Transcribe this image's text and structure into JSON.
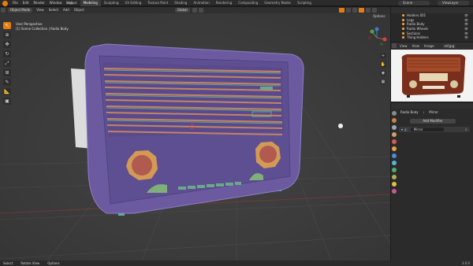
{
  "menu": {
    "items": [
      "File",
      "Edit",
      "Render",
      "Window",
      "Help"
    ]
  },
  "workspace_tabs": [
    "Layout",
    "Modeling",
    "Sculpting",
    "UV Editing",
    "Texture Paint",
    "Shading",
    "Animation",
    "Rendering",
    "Compositing",
    "Geometry Nodes",
    "Scripting"
  ],
  "active_tab": "Modeling",
  "scene_name": "Scene",
  "view_layer": "ViewLayer",
  "viewport": {
    "mode": "Object Mode",
    "menus": [
      "View",
      "Select",
      "Add",
      "Object"
    ],
    "orientation": "Global",
    "info_line1": "User Perspective",
    "info_line2": "(1) Scene Collection | Radio Body",
    "options_label": "Options"
  },
  "outliner": {
    "rows": [
      "Holders.001",
      "Legs",
      "Radio Body",
      "Radio Wheels",
      "Sections",
      "Thing Holders"
    ]
  },
  "image_editor": {
    "menus": [
      "View",
      "View",
      "Image"
    ],
    "image_name": "ref.jpg"
  },
  "properties": {
    "object": "Radio Body",
    "modifier_panel": "Mirror",
    "add_modifier_label": "Add Modifier",
    "modifier_name": "Mirror"
  },
  "status": {
    "items": [
      "Select",
      "Rotate View",
      "Options"
    ],
    "version": "3.0.0"
  },
  "colors": {
    "accent": "#e87d0d",
    "radio_body": "#6b5aa0",
    "grille": "#c08565",
    "knob_face": "#b05a50",
    "knob_rim": "#d39a56",
    "foot": "#5bb3a2"
  }
}
